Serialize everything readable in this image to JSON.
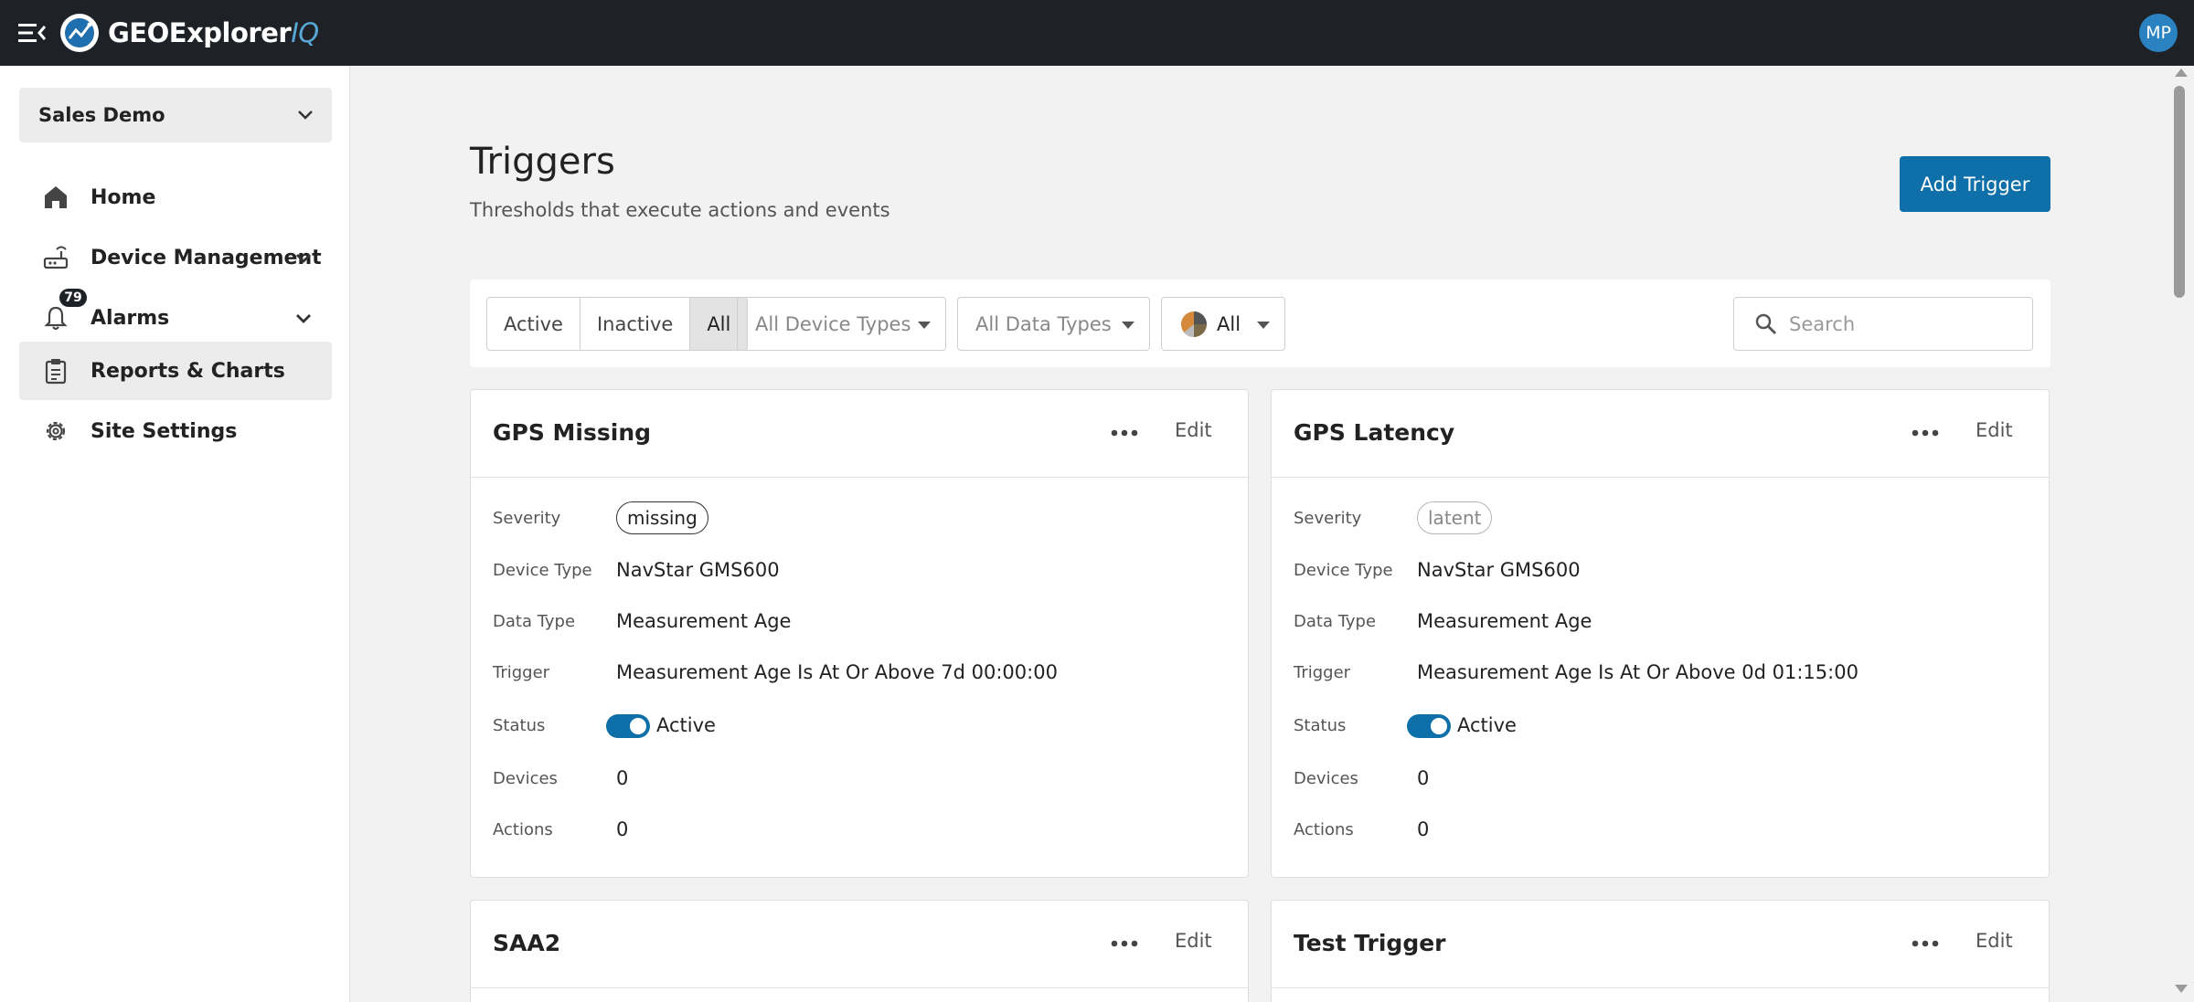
{
  "app": {
    "name": "GEOExplorer",
    "name_suffix": "IQ",
    "user_initials": "MP"
  },
  "sidebar": {
    "org": "Sales Demo",
    "items": [
      {
        "label": "Home",
        "icon": "home-icon"
      },
      {
        "label": "Device Management",
        "icon": "router-icon",
        "expandable": true
      },
      {
        "label": "Alarms",
        "icon": "bell-icon",
        "expandable": true,
        "badge": "79"
      },
      {
        "label": "Reports & Charts",
        "icon": "clipboard-icon",
        "selected": true
      },
      {
        "label": "Site Settings",
        "icon": "gear-icon"
      }
    ]
  },
  "page": {
    "title": "Triggers",
    "subtitle": "Thresholds that execute actions and events",
    "add_button": "Add Trigger"
  },
  "filters": {
    "status_options": [
      "Active",
      "Inactive",
      "All"
    ],
    "status_selected": "All",
    "device_types": "All Device Types",
    "data_types": "All Data Types",
    "severity": "All",
    "search_placeholder": "Search"
  },
  "labels": {
    "severity": "Severity",
    "device_type": "Device Type",
    "data_type": "Data Type",
    "trigger": "Trigger",
    "status": "Status",
    "devices": "Devices",
    "actions": "Actions",
    "edit": "Edit"
  },
  "triggers": [
    {
      "name": "GPS Missing",
      "severity": "missing",
      "severity_style": "dark",
      "device_type": "NavStar GMS600",
      "data_type": "Measurement Age",
      "trigger": "Measurement Age Is At Or Above 7d 00:00:00",
      "status": "Active",
      "devices": "0",
      "actions": "0"
    },
    {
      "name": "GPS Latency",
      "severity": "latent",
      "severity_style": "light",
      "device_type": "NavStar GMS600",
      "data_type": "Measurement Age",
      "trigger": "Measurement Age Is At Or Above 0d 01:15:00",
      "status": "Active",
      "devices": "0",
      "actions": "0"
    },
    {
      "name": "SAA2"
    },
    {
      "name": "Test Trigger"
    }
  ],
  "colors": {
    "topbar": "#1e2126",
    "accent": "#0f6fa8",
    "avatar": "#2b82c0"
  }
}
